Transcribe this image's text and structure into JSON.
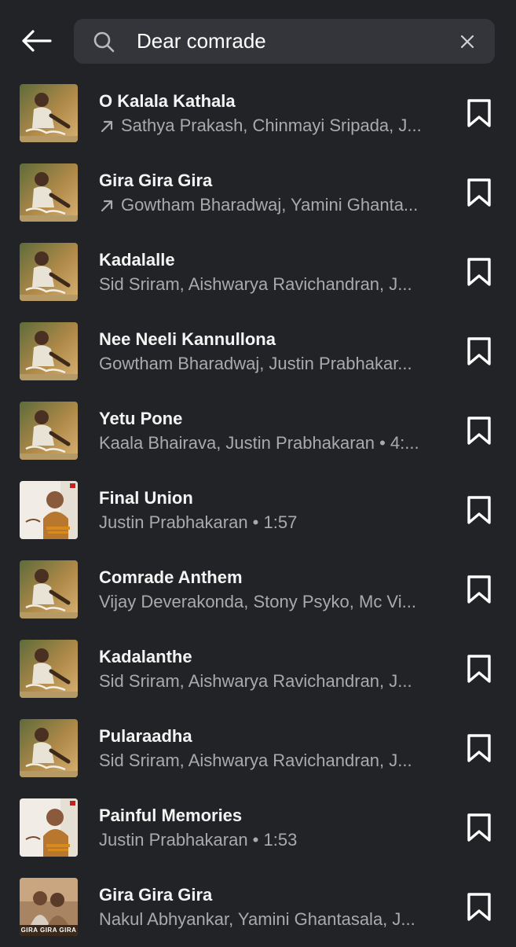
{
  "search": {
    "value": "Dear comrade",
    "placeholder": "Search"
  },
  "icons": {
    "back": "arrow-left-icon",
    "search": "search-icon",
    "clear": "close-icon",
    "bookmark": "bookmark-icon",
    "trending": "trending-arrow-icon"
  },
  "colors": {
    "background": "#222326",
    "search_box": "#33353a",
    "title_text": "#f4f4f4",
    "subtitle_text": "#a9aaae"
  },
  "results": [
    {
      "title": "O Kalala Kathala",
      "subtitle": "Sathya Prakash, Chinmayi Sripada, J...",
      "trending": true,
      "art": "green"
    },
    {
      "title": "Gira Gira Gira",
      "subtitle": "Gowtham Bharadwaj, Yamini Ghanta...",
      "trending": true,
      "art": "green"
    },
    {
      "title": "Kadalalle",
      "subtitle": "Sid Sriram, Aishwarya Ravichandran, J...",
      "trending": false,
      "art": "green"
    },
    {
      "title": "Nee Neeli Kannullona",
      "subtitle": "Gowtham Bharadwaj, Justin Prabhakar...",
      "trending": false,
      "art": "green"
    },
    {
      "title": "Yetu Pone",
      "subtitle": "Kaala Bhairava, Justin Prabhakaran • 4:...",
      "trending": false,
      "art": "green"
    },
    {
      "title": "Final Union",
      "subtitle": "Justin Prabhakaran • 1:57",
      "trending": false,
      "art": "white"
    },
    {
      "title": "Comrade Anthem",
      "subtitle": "Vijay Deverakonda, Stony Psyko, Mc Vi...",
      "trending": false,
      "art": "green"
    },
    {
      "title": "Kadalanthe",
      "subtitle": "Sid Sriram, Aishwarya Ravichandran, J...",
      "trending": false,
      "art": "green"
    },
    {
      "title": "Pularaadha",
      "subtitle": "Sid Sriram, Aishwarya Ravichandran, J...",
      "trending": false,
      "art": "green"
    },
    {
      "title": "Painful Memories",
      "subtitle": "Justin Prabhakaran • 1:53",
      "trending": false,
      "art": "white"
    },
    {
      "title": "Gira Gira Gira",
      "subtitle": "Nakul Abhyankar, Yamini Ghantasala, J...",
      "trending": false,
      "art": "couple",
      "art_caption": "GIRA GIRA GIRA"
    }
  ]
}
